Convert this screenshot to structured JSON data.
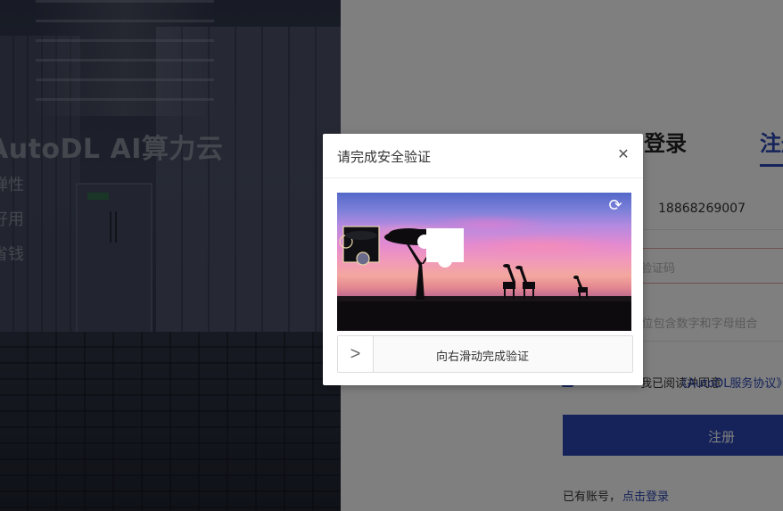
{
  "hero": {
    "title": "AutoDL AI算力云",
    "features": [
      "弹性",
      "好用",
      "省钱"
    ]
  },
  "register": {
    "tab_login": "登录",
    "tab_register": "注册",
    "phone_value": "18868269007",
    "code_placeholder": "验证码",
    "password_placeholder": "8-16位包含数字和字母组合",
    "agree_text": "我已阅读并同意",
    "agree_link": "《AutoDL服务协议》",
    "submit_label": "注册",
    "have_account_text": "已有账号，",
    "login_link": "点击登录"
  },
  "captcha": {
    "title": "请完成安全验证",
    "close_icon": "close-icon",
    "refresh_icon": "refresh-icon",
    "slider_icon": "chevron-right-icon",
    "slider_hint": "向右滑动完成验证"
  },
  "colors": {
    "accent": "#2b47b4",
    "overlay": "rgba(0,0,0,0.5)"
  }
}
